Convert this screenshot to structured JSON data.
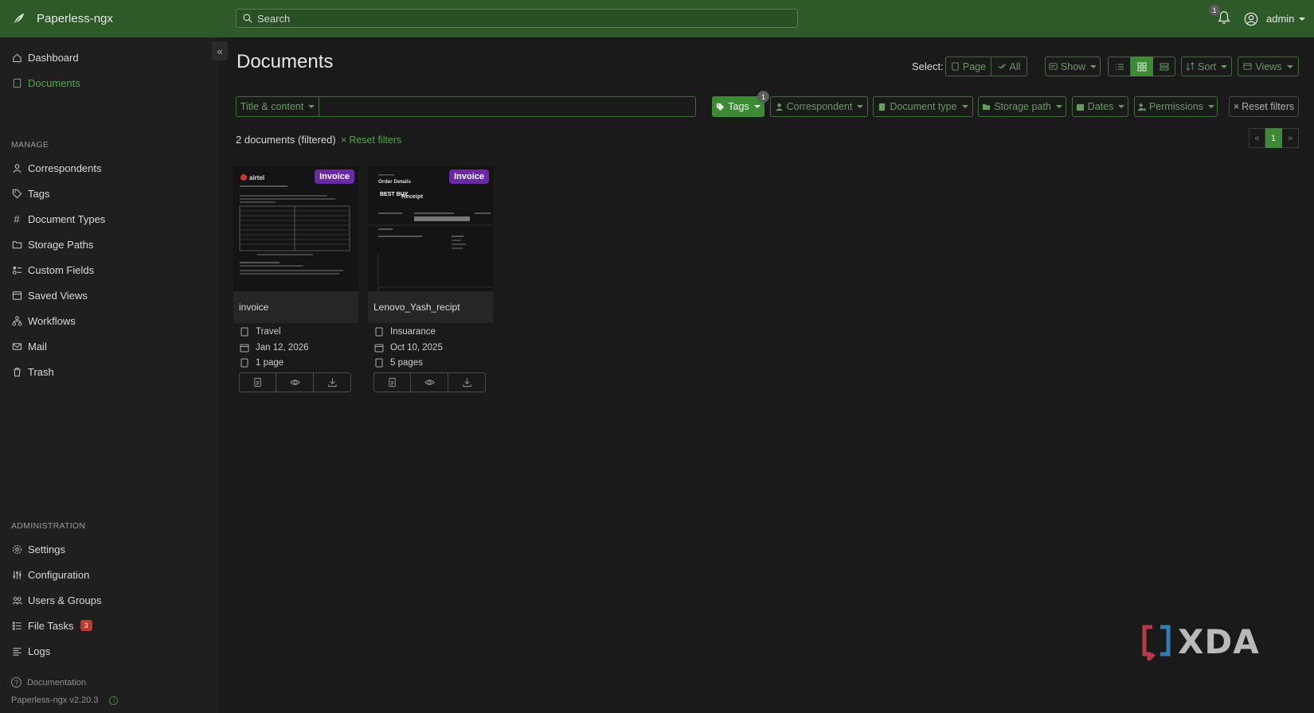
{
  "app": {
    "title": "Paperless-ngx"
  },
  "search": {
    "placeholder": "Search"
  },
  "notifications": {
    "count": "1"
  },
  "user": {
    "name": "admin"
  },
  "sidebar": {
    "main_items": [
      {
        "label": "Dashboard",
        "icon": "house-icon"
      },
      {
        "label": "Documents",
        "icon": "file-icon",
        "active": true
      }
    ],
    "manage_heading": "MANAGE",
    "manage_items": [
      {
        "label": "Correspondents",
        "icon": "person-icon"
      },
      {
        "label": "Tags",
        "icon": "tags-icon"
      },
      {
        "label": "Document Types",
        "icon": "hash-icon"
      },
      {
        "label": "Storage Paths",
        "icon": "folder-icon"
      },
      {
        "label": "Custom Fields",
        "icon": "ui-radios-icon"
      },
      {
        "label": "Saved Views",
        "icon": "window-stack-icon"
      },
      {
        "label": "Workflows",
        "icon": "diagram-icon"
      },
      {
        "label": "Mail",
        "icon": "envelope-icon"
      },
      {
        "label": "Trash",
        "icon": "trash-icon"
      }
    ],
    "admin_heading": "ADMINISTRATION",
    "admin_items": [
      {
        "label": "Settings",
        "icon": "gear-icon"
      },
      {
        "label": "Configuration",
        "icon": "sliders-icon"
      },
      {
        "label": "Users & Groups",
        "icon": "people-icon"
      },
      {
        "label": "File Tasks",
        "icon": "list-task-icon",
        "badge": "3"
      },
      {
        "label": "Logs",
        "icon": "text-left-icon"
      }
    ],
    "documentation": "Documentation",
    "version": "Paperless-ngx v2.20.3"
  },
  "main": {
    "title": "Documents",
    "select_label": "Select:",
    "select_page": "Page",
    "select_all": "All",
    "show_label": "Show",
    "sort_label": "Sort",
    "views_label": "Views",
    "filters": {
      "title_content": "Title & content",
      "tags": "Tags",
      "tags_count": "1",
      "correspondent": "Correspondent",
      "document_type": "Document type",
      "storage_path": "Storage path",
      "dates": "Dates",
      "permissions": "Permissions",
      "reset": "Reset filters"
    },
    "doc_count": "2 documents (filtered)",
    "reset_filters": "Reset filters",
    "pagination": {
      "prev": "«",
      "current": "1",
      "next": "»"
    }
  },
  "documents": [
    {
      "title": "invoice",
      "tag": "Invoice",
      "document_type": "Travel",
      "date": "Jan 12, 2026",
      "pages": "1 page",
      "thumb_brand": "airtel"
    },
    {
      "title": "Lenovo_Yash_recipt",
      "tag": "Invoice",
      "document_type": "Insuarance",
      "date": "Oct 10, 2025",
      "pages": "5 pages",
      "thumb_heading": "Order Details",
      "thumb_logo": "BEST BUY",
      "thumb_receipt": "Receipt"
    }
  ],
  "watermark": {
    "text": "XDA"
  },
  "colors": {
    "navbar": "#2e5a29",
    "accent": "#3d8a35",
    "tag_badge": "#6a2aa8",
    "tasks_badge": "#c0392b",
    "background": "#1a1a1a",
    "sidebar": "#1f1f1f"
  }
}
